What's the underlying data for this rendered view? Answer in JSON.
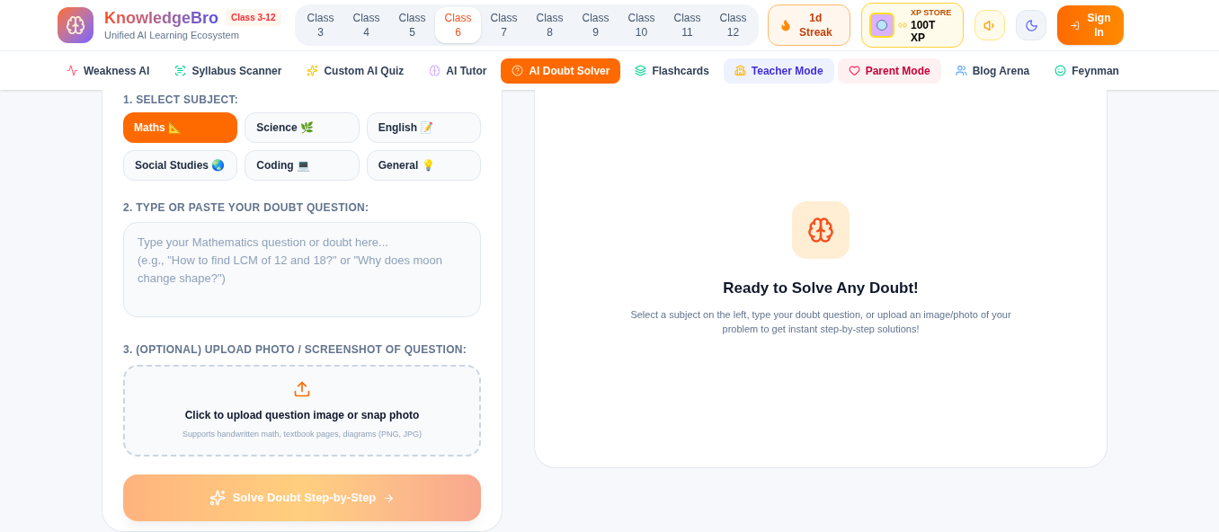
{
  "brand": {
    "name": "KnowledgeBro",
    "badge": "Class 3-12",
    "tagline": "Unified AI Learning Ecosystem"
  },
  "classes": [
    {
      "label": "Class",
      "number": "3",
      "selected": false
    },
    {
      "label": "Class",
      "number": "4",
      "selected": false
    },
    {
      "label": "Class",
      "number": "5",
      "selected": false
    },
    {
      "label": "Class",
      "number": "6",
      "selected": true
    },
    {
      "label": "Class",
      "number": "7",
      "selected": false
    },
    {
      "label": "Class",
      "number": "8",
      "selected": false
    },
    {
      "label": "Class",
      "number": "9",
      "selected": false
    },
    {
      "label": "Class",
      "number": "10",
      "selected": false
    },
    {
      "label": "Class",
      "number": "11",
      "selected": false
    },
    {
      "label": "Class",
      "number": "12",
      "selected": false
    }
  ],
  "streak": {
    "value": "1d",
    "label": "Streak"
  },
  "xp_store": {
    "title": "XP STORE",
    "value": "100T",
    "unit": "XP"
  },
  "sign_in": "Sign In",
  "nav": [
    {
      "label": "Weakness AI",
      "kind": "plain"
    },
    {
      "label": "Syllabus Scanner",
      "kind": "plain"
    },
    {
      "label": "Custom AI Quiz",
      "kind": "plain"
    },
    {
      "label": "AI Tutor",
      "kind": "plain"
    },
    {
      "label": "AI Doubt Solver",
      "kind": "active"
    },
    {
      "label": "Flashcards",
      "kind": "plain"
    },
    {
      "label": "Teacher Mode",
      "kind": "teacher"
    },
    {
      "label": "Parent Mode",
      "kind": "parent"
    },
    {
      "label": "Blog Arena",
      "kind": "plain"
    },
    {
      "label": "Feynman",
      "kind": "plain"
    }
  ],
  "step1": {
    "title": "1. SELECT SUBJECT:",
    "subjects": [
      {
        "label": "Maths 📐",
        "selected": true
      },
      {
        "label": "Science 🌿",
        "selected": false
      },
      {
        "label": "English 📝",
        "selected": false
      },
      {
        "label": "Social Studies 🌏",
        "selected": false
      },
      {
        "label": "Coding 💻",
        "selected": false
      },
      {
        "label": "General 💡",
        "selected": false
      }
    ]
  },
  "step2": {
    "title": "2. TYPE OR PASTE YOUR DOUBT QUESTION:",
    "placeholder": "Type your Mathematics question or doubt here...\n(e.g., \"How to find LCM of 12 and 18?\" or \"Why does moon change shape?\")"
  },
  "step3": {
    "title": "3. (OPTIONAL) UPLOAD PHOTO / SCREENSHOT OF QUESTION:",
    "upload_title": "Click to upload question image or snap photo",
    "upload_hint": "Supports handwritten math, textbook pages, diagrams (PNG, JPG)"
  },
  "solve_button": {
    "label": "Solve Doubt Step-by-Step",
    "disabled": true
  },
  "result": {
    "title": "Ready to Solve Any Doubt!",
    "description": "Select a subject on the left, type your doubt question, or upload an image/photo of your problem to get instant step-by-step solutions!"
  }
}
